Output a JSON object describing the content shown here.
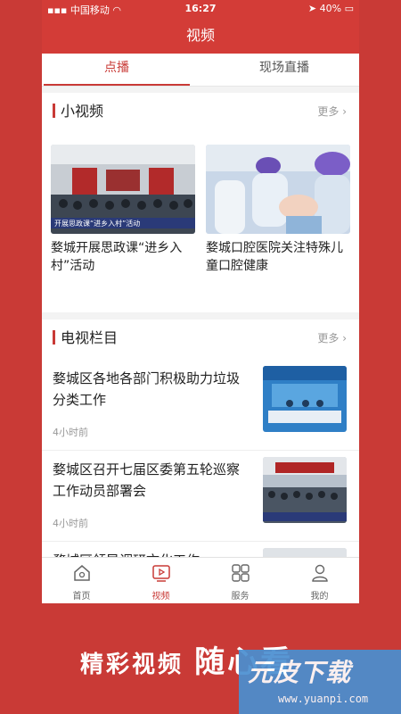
{
  "status_bar": {
    "carrier": "中国移动",
    "time": "16:27",
    "battery": "40%"
  },
  "header": {
    "title": "视频"
  },
  "tabs": [
    {
      "label": "点播",
      "active": true
    },
    {
      "label": "现场直播",
      "active": false
    }
  ],
  "short_videos": {
    "heading": "小视频",
    "more": "更多",
    "items": [
      {
        "caption": "婺城开展思政课“进乡入村”活动",
        "overlay_text": "开展思政课“进乡入村”活动"
      },
      {
        "caption": "婺城口腔医院关注特殊儿童口腔健康"
      }
    ]
  },
  "tv_columns": {
    "heading": "电视栏目",
    "more": "更多",
    "items": [
      {
        "title": "婺城区各地各部门积极助力垃圾分类工作",
        "time": "4小时前"
      },
      {
        "title": "婺城区召开七届区委第五轮巡察工作动员部署会",
        "time": "4小时前"
      },
      {
        "title": "婺城区领导调研文化工作",
        "time": ""
      }
    ]
  },
  "bottom_nav": [
    {
      "label": "首页",
      "icon": "home-icon",
      "active": false
    },
    {
      "label": "视频",
      "icon": "video-icon",
      "active": true
    },
    {
      "label": "服务",
      "icon": "grid-icon",
      "active": false
    },
    {
      "label": "我的",
      "icon": "user-icon",
      "active": false
    }
  ],
  "promo": {
    "text_a": "精彩视频",
    "text_b": "随心看"
  },
  "watermark": {
    "name": "元皮下载",
    "url": "www.yuanpi.com"
  },
  "colors": {
    "brand_red": "#d33c37",
    "accent": "#c93a36"
  }
}
